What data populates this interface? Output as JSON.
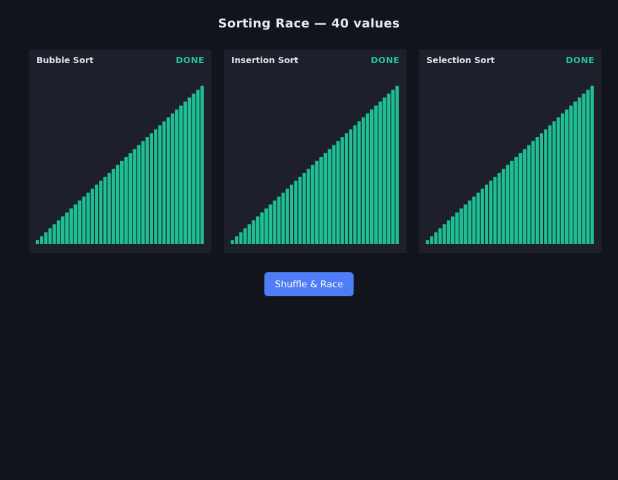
{
  "title": "Sorting Race — 40 values",
  "value_count": 40,
  "colors": {
    "background": "#12141b",
    "panel": "#1d1f2a",
    "bar": "#1fbf94",
    "status_done": "#26c49a",
    "button": "#4f7cf7"
  },
  "panels": [
    {
      "name": "Bubble Sort",
      "status": "DONE",
      "values": [
        1,
        2,
        3,
        4,
        5,
        6,
        7,
        8,
        9,
        10,
        11,
        12,
        13,
        14,
        15,
        16,
        17,
        18,
        19,
        20,
        21,
        22,
        23,
        24,
        25,
        26,
        27,
        28,
        29,
        30,
        31,
        32,
        33,
        34,
        35,
        36,
        37,
        38,
        39,
        40
      ]
    },
    {
      "name": "Insertion Sort",
      "status": "DONE",
      "values": [
        1,
        2,
        3,
        4,
        5,
        6,
        7,
        8,
        9,
        10,
        11,
        12,
        13,
        14,
        15,
        16,
        17,
        18,
        19,
        20,
        21,
        22,
        23,
        24,
        25,
        26,
        27,
        28,
        29,
        30,
        31,
        32,
        33,
        34,
        35,
        36,
        37,
        38,
        39,
        40
      ]
    },
    {
      "name": "Selection Sort",
      "status": "DONE",
      "values": [
        1,
        2,
        3,
        4,
        5,
        6,
        7,
        8,
        9,
        10,
        11,
        12,
        13,
        14,
        15,
        16,
        17,
        18,
        19,
        20,
        21,
        22,
        23,
        24,
        25,
        26,
        27,
        28,
        29,
        30,
        31,
        32,
        33,
        34,
        35,
        36,
        37,
        38,
        39,
        40
      ]
    }
  ],
  "button": {
    "label": "Shuffle & Race"
  }
}
